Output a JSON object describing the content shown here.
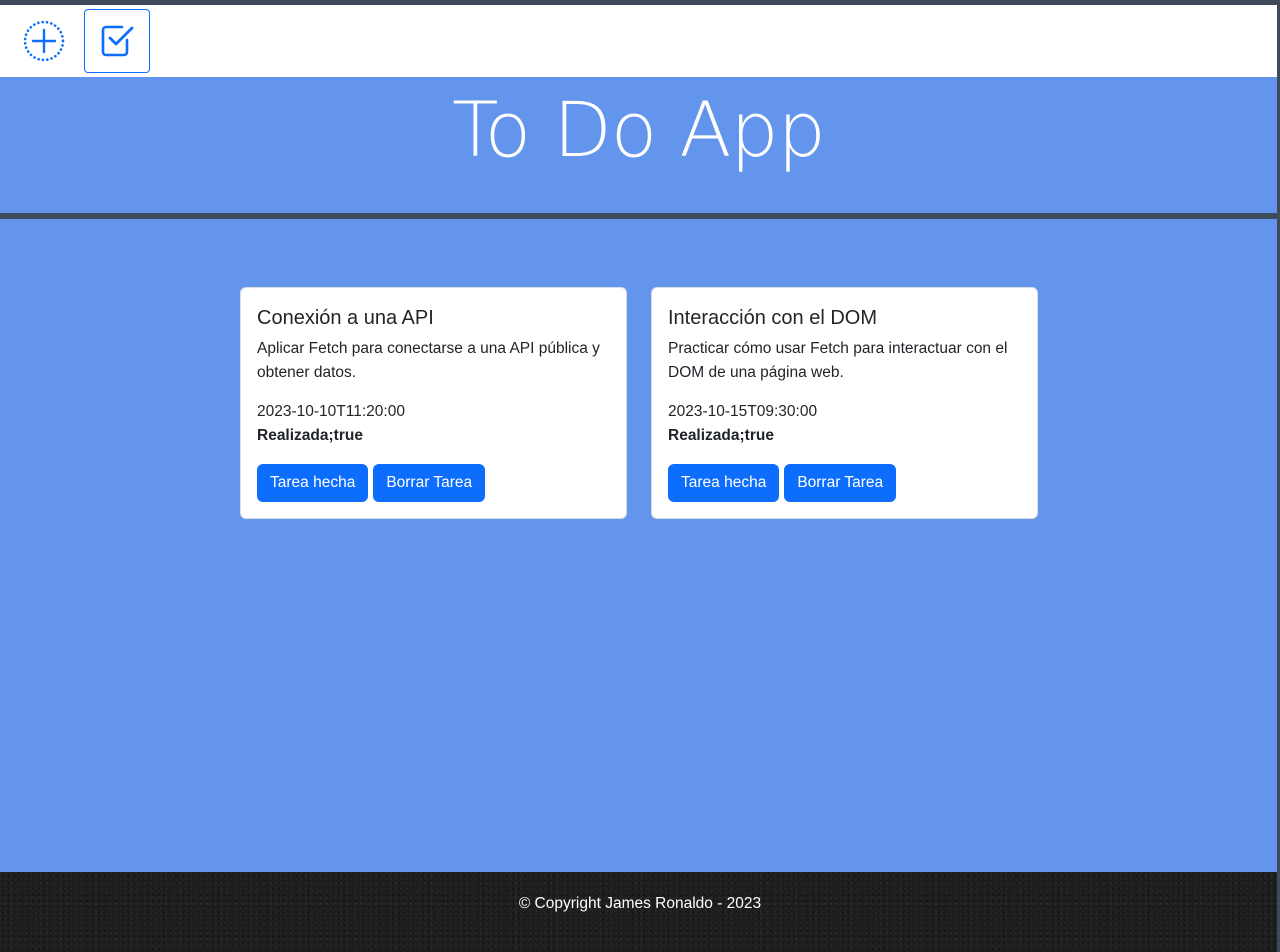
{
  "toolbar": {
    "add_icon": "plus-circle-dotted-icon",
    "done_icon": "check-square-icon"
  },
  "header": {
    "title": "To Do App"
  },
  "tasks": [
    {
      "title": "Conexión a una API",
      "description": "Aplicar Fetch para conectarse a una API pública y obtener datos.",
      "date": "2023-10-10T11:20:00",
      "status": "Realizada;true",
      "done_label": "Tarea hecha",
      "delete_label": "Borrar Tarea"
    },
    {
      "title": "Interacción con el DOM",
      "description": "Practicar cómo usar Fetch para interactuar con el DOM de una página web.",
      "date": "2023-10-15T09:30:00",
      "status": "Realizada;true",
      "done_label": "Tarea hecha",
      "delete_label": "Borrar Tarea"
    }
  ],
  "footer": {
    "copyright": "© Copyright James Ronaldo - 2023"
  },
  "colors": {
    "background": "#6495ed",
    "primary": "#0d6efd",
    "frame": "#3d4b5a",
    "footer": "#1c1d1e"
  }
}
